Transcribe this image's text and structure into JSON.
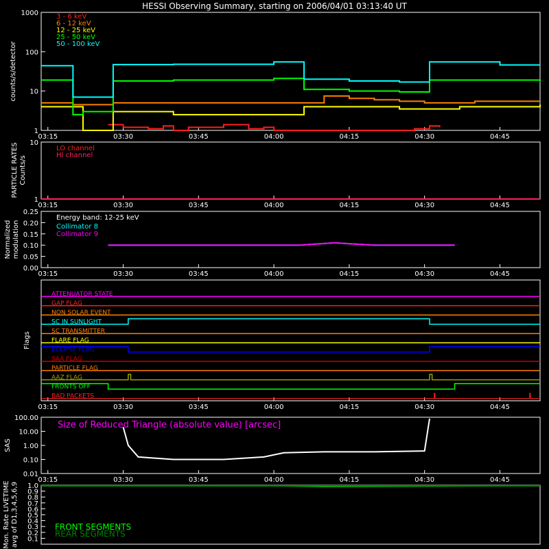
{
  "title": "HESSI Observing Summary, starting on 2006/04/01 03:13:40 UT",
  "time_ticks": [
    "03:15",
    "03:30",
    "03:45",
    "04:00",
    "04:15",
    "04:30",
    "04:45"
  ],
  "colors": {
    "red": "#ff2020",
    "orange": "#ff8000",
    "yellow": "#ffff00",
    "green": "#00ff00",
    "cyan": "#00ffff",
    "magenta": "#ff00ff",
    "white": "#ffffff",
    "blue": "#0000ff",
    "dkred": "#d00000",
    "olive": "#a0a000",
    "dkgreen": "#008000"
  },
  "chart_data": [
    {
      "type": "line",
      "panel": "count_rates",
      "ylabel": "counts/s/detector",
      "yscale": "log",
      "ylim": [
        1,
        1000
      ],
      "y_ticks": [
        "1",
        "10",
        "100",
        "1000"
      ],
      "xlim": [
        "03:13:40",
        "04:53:00"
      ],
      "series": [
        {
          "name": "3 - 6 keV",
          "color": "#ff2020",
          "x": [
            "03:27",
            "03:30",
            "03:35",
            "03:38",
            "03:40",
            "03:43",
            "03:50",
            "03:55",
            "03:58",
            "04:00",
            "04:28",
            "04:31",
            "04:33"
          ],
          "values": [
            1.4,
            1.2,
            1.1,
            1.3,
            1.0,
            1.2,
            1.4,
            1.1,
            1.2,
            1.0,
            1.1,
            1.3,
            1.2
          ]
        },
        {
          "name": "6 - 12 keV",
          "color": "#ff8000",
          "x": [
            "03:13:40",
            "03:20",
            "03:28",
            "03:40",
            "04:00",
            "04:06",
            "04:10",
            "04:15",
            "04:20",
            "04:25",
            "04:30",
            "04:40",
            "04:53"
          ],
          "values": [
            5.0,
            4.5,
            5.0,
            5.0,
            5.0,
            5.0,
            7.5,
            6.5,
            6.0,
            5.5,
            5.0,
            5.5,
            5.5
          ]
        },
        {
          "name": "12 - 25 keV",
          "color": "#ffff00",
          "x": [
            "03:13:40",
            "03:20",
            "03:22",
            "03:28",
            "03:40",
            "04:00",
            "04:06",
            "04:15",
            "04:25",
            "04:30",
            "04:37",
            "04:53"
          ],
          "values": [
            4.0,
            4.0,
            1.0,
            3.0,
            2.5,
            2.5,
            4.0,
            4.0,
            3.5,
            3.5,
            4.0,
            4.5
          ]
        },
        {
          "name": "25 - 50 keV",
          "color": "#00ff00",
          "x": [
            "03:13:40",
            "03:18",
            "03:20",
            "03:22",
            "03:28",
            "03:40",
            "04:00",
            "04:06",
            "04:15",
            "04:25",
            "04:31",
            "04:53"
          ],
          "values": [
            19,
            19,
            2.5,
            3.0,
            18,
            19,
            21,
            11,
            10,
            9.5,
            19,
            18
          ]
        },
        {
          "name": "50 - 100 keV",
          "color": "#00ffff",
          "x": [
            "03:13:40",
            "03:18",
            "03:20",
            "03:22",
            "03:28",
            "03:40",
            "04:00",
            "04:06",
            "04:15",
            "04:25",
            "04:31",
            "04:45",
            "04:53"
          ],
          "values": [
            44,
            44,
            7,
            7,
            47,
            48,
            55,
            20,
            18,
            17,
            55,
            46,
            46
          ]
        }
      ]
    },
    {
      "type": "line",
      "panel": "particle_rates",
      "ylabel": "PARTICLE RATES Counts/s",
      "y_ticks": [
        "1",
        "10"
      ],
      "series": [
        {
          "name": "LO channel",
          "color": "#ff2020",
          "x": [
            "03:13:40",
            "04:53:00"
          ],
          "values": [
            1,
            1
          ]
        },
        {
          "name": "HI channel",
          "color": "#ff2060",
          "x": [
            "03:13:40",
            "04:53:00"
          ],
          "values": [
            1,
            1
          ]
        }
      ]
    },
    {
      "type": "line",
      "panel": "modulation",
      "ylabel": "Normalized modulation",
      "ylim": [
        0,
        0.25
      ],
      "y_ticks": [
        "0.00",
        "0.05",
        "0.10",
        "0.15",
        "0.20",
        "0.25"
      ],
      "annotation": "Energy band: 12-25 keV",
      "series": [
        {
          "name": "Collimator 8",
          "color": "#00ffff",
          "x": [
            "03:27",
            "03:35",
            "03:45",
            "03:55",
            "04:05",
            "04:12",
            "04:20",
            "04:28",
            "04:36"
          ],
          "values": [
            0.1,
            0.1,
            0.1,
            0.1,
            0.1,
            0.11,
            0.1,
            0.1,
            0.1
          ]
        },
        {
          "name": "Collimator 9",
          "color": "#ff00ff",
          "x": [
            "03:27",
            "03:35",
            "03:45",
            "03:55",
            "04:05",
            "04:12",
            "04:20",
            "04:28",
            "04:36"
          ],
          "values": [
            0.1,
            0.1,
            0.1,
            0.1,
            0.1,
            0.11,
            0.1,
            0.1,
            0.1
          ]
        }
      ]
    },
    {
      "type": "line",
      "panel": "flags",
      "ylabel": "Flags",
      "flags": [
        {
          "name": "ATTENUATOR STATE",
          "color": "#ff00ff",
          "x": [
            "03:13:40",
            "04:53:00"
          ],
          "values": [
            0,
            0
          ]
        },
        {
          "name": "GAP FLAG",
          "color": "#ff2020",
          "x": [
            "03:13:40",
            "04:53:00"
          ],
          "values": [
            0,
            0
          ]
        },
        {
          "name": "NON SOLAR EVENT",
          "color": "#ff8000",
          "x": [
            "03:13:40",
            "04:53:00"
          ],
          "values": [
            0,
            0
          ]
        },
        {
          "name": "SC IN SUNLIGHT",
          "color": "#00ffff",
          "x": [
            "03:13:40",
            "03:31",
            "03:31",
            "04:31",
            "04:31",
            "04:53:00"
          ],
          "values": [
            0,
            0,
            1,
            1,
            0,
            0
          ]
        },
        {
          "name": "SC TRANSMITTER",
          "color": "#ff8000",
          "x": [
            "03:13:40",
            "04:53:00"
          ],
          "values": [
            0,
            0
          ]
        },
        {
          "name": "FLARE FLAG",
          "color": "#ffff00",
          "x": [
            "03:13:40",
            "04:53:00"
          ],
          "values": [
            0,
            0
          ]
        },
        {
          "name": "ECLIPSE FLAG",
          "color": "#0000ff",
          "x": [
            "03:13:40",
            "03:31",
            "03:31",
            "04:31",
            "04:31",
            "04:53:00"
          ],
          "values": [
            1,
            1,
            0,
            0,
            1,
            1
          ]
        },
        {
          "name": "SAA FLAG",
          "color": "#d00000",
          "x": [
            "03:13:40",
            "04:53:00"
          ],
          "values": [
            0,
            0
          ]
        },
        {
          "name": "PARTICLE FLAG",
          "color": "#ff8000",
          "x": [
            "03:13:40",
            "04:53:00"
          ],
          "values": [
            0,
            0
          ]
        },
        {
          "name": "AAZ FLAG",
          "color": "#a0a000",
          "x": [
            "03:13:40",
            "03:31",
            "03:31",
            "03:31:30",
            "03:31:30",
            "04:31",
            "04:31",
            "04:31:30",
            "04:31:30",
            "04:53:00"
          ],
          "values": [
            0,
            0,
            1,
            1,
            0,
            0,
            1,
            1,
            0,
            0
          ]
        },
        {
          "name": "FRONTS OFF",
          "color": "#00ff00",
          "x": [
            "03:13:40",
            "03:27",
            "03:27",
            "04:36",
            "04:36",
            "04:53:00"
          ],
          "values": [
            1,
            1,
            0,
            0,
            1,
            1
          ]
        },
        {
          "name": "BAD PACKETS",
          "color": "#ff2020",
          "x": [
            "04:32",
            "04:51"
          ],
          "values": [
            1,
            1
          ]
        }
      ]
    },
    {
      "type": "line",
      "panel": "sas",
      "ylabel": "SAS",
      "yscale": "log",
      "ylim": [
        0.01,
        100
      ],
      "y_ticks": [
        "100.00",
        "10.00",
        "1.00",
        "0.10",
        "0.01"
      ],
      "annotation": "Size of Reduced Triangle (absolute value) [arcsec]",
      "series": [
        {
          "name": "SAS",
          "color": "#ffffff",
          "x": [
            "03:30",
            "03:31",
            "03:33",
            "03:40",
            "03:50",
            "03:58",
            "04:02",
            "04:10",
            "04:20",
            "04:30",
            "04:31"
          ],
          "values": [
            20,
            1,
            0.15,
            0.1,
            0.1,
            0.15,
            0.3,
            0.35,
            0.35,
            0.4,
            80
          ]
        }
      ]
    },
    {
      "type": "line",
      "panel": "livetime",
      "ylabel": "Mon. Rate LIVETIME avg of D1,3,4,5,6,9",
      "ylim": [
        0,
        1
      ],
      "y_ticks": [
        "1.0",
        "0.9",
        "0.8",
        "0.7",
        "0.6",
        "0.5",
        "0.4",
        "0.3",
        "0.2",
        "0.1"
      ],
      "series": [
        {
          "name": "FRONT SEGMENTS",
          "color": "#00ff00",
          "x": [
            "03:13:40",
            "04:00",
            "04:10",
            "04:53:00"
          ],
          "values": [
            0.99,
            0.99,
            0.98,
            0.99
          ]
        },
        {
          "name": "REAR SEGMENTS",
          "color": "#008000",
          "x": [
            "03:13:40",
            "04:53:00"
          ],
          "values": [
            0.99,
            0.99
          ]
        }
      ]
    }
  ]
}
